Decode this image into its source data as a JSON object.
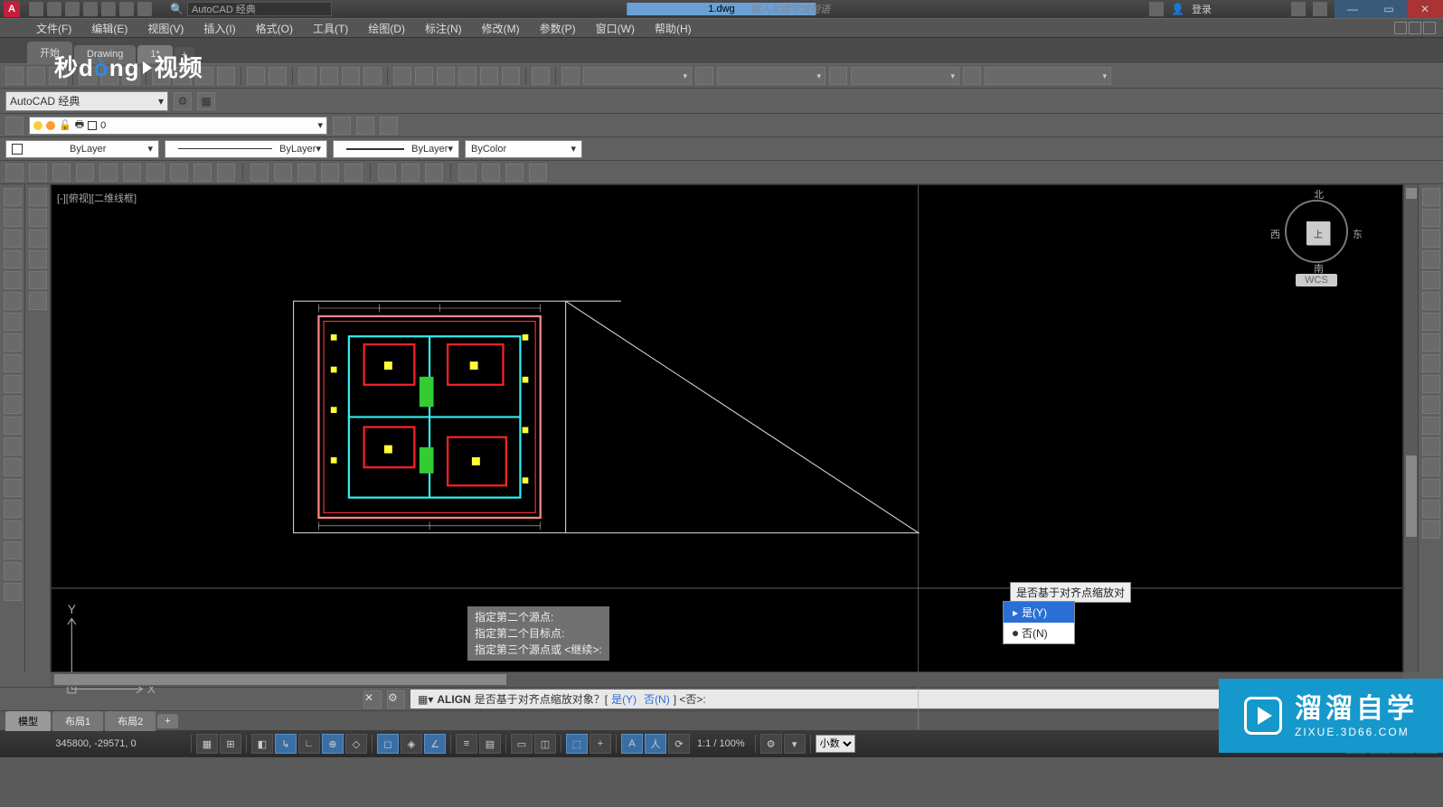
{
  "title": {
    "app": "AutoCAD 经典",
    "doc": "1.dwg",
    "search_placeholder": "AutoCAD 经典",
    "keyword_hint": "键入关键字或短语",
    "login": "登录"
  },
  "menu": [
    "文件(F)",
    "编辑(E)",
    "视图(V)",
    "插入(I)",
    "格式(O)",
    "工具(T)",
    "绘图(D)",
    "标注(N)",
    "修改(M)",
    "参数(P)",
    "窗口(W)",
    "帮助(H)"
  ],
  "doctabs": {
    "start": "开始",
    "t1": "Drawing",
    "t2": "1*",
    "add": "+"
  },
  "workspace": {
    "combo": "AutoCAD 经典"
  },
  "layer": {
    "combo": "0",
    "icons": [
      "bulb",
      "sun",
      "lock",
      "print",
      "square"
    ]
  },
  "props": {
    "color": "ByLayer",
    "ltype": "ByLayer",
    "lweight": "ByLayer",
    "plot": "ByColor"
  },
  "viewport": {
    "label": "[-][俯视][二维线框]"
  },
  "viewcube": {
    "n": "北",
    "s": "南",
    "e": "东",
    "w": "西",
    "top": "上",
    "wcs": "WCS"
  },
  "ucs": {
    "x": "X",
    "y": "Y"
  },
  "cmdhist": [
    "指定第二个源点:",
    "指定第二个目标点:",
    "指定第三个源点或 <继续>:"
  ],
  "popup": {
    "prompt": "是否基于对齐点缩放对",
    "yes": "是(Y)",
    "no": "否(N)"
  },
  "cmdline": {
    "icon": "⌨",
    "cmd": "ALIGN",
    "text": "是否基于对齐点缩放对象？[",
    "yes": "是(Y)",
    "sep": " ",
    "no": "否(N)",
    "tail": "] <否>:"
  },
  "layout_tabs": [
    "模型",
    "布局1",
    "布局2"
  ],
  "status": {
    "coord": "345800, -29571, 0",
    "zoom": "1:1 / 100%",
    "annoscale": "小数"
  },
  "watermark_tl": {
    "a": "秒",
    "b": "d",
    "c": "ng",
    "d": "视频"
  },
  "watermark_br": {
    "big": "溜溜自学",
    "small": "ZIXUE.3D66.COM"
  },
  "chart_data": null
}
